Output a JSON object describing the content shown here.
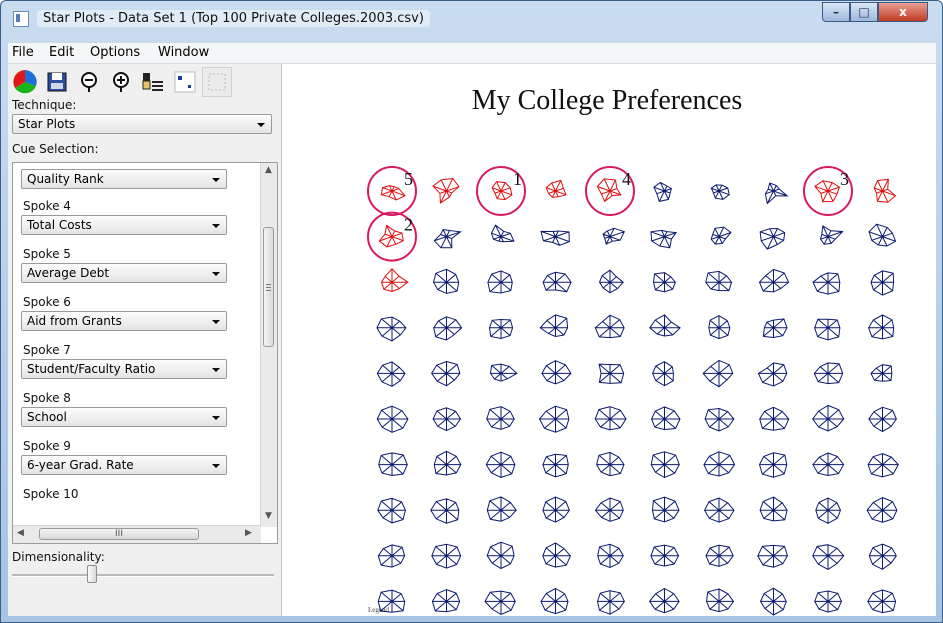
{
  "window": {
    "title": "Star Plots - Data Set 1 (Top 100 Private Colleges.2003.csv)",
    "controls": {
      "minimize": "–",
      "maximize": "□",
      "close": "x"
    }
  },
  "menu": [
    "File",
    "Edit",
    "Options",
    "Window"
  ],
  "toolbar": {
    "buttons": [
      "color-wheel-icon",
      "save-icon",
      "zoom-out-icon",
      "zoom-in-icon",
      "cue-settings-icon",
      "scatter-icon",
      "grid-icon"
    ]
  },
  "sidebar": {
    "technique_label": "Technique:",
    "technique_value": "Star Plots",
    "cue_selection_label": "Cue Selection:",
    "cues": [
      {
        "label": "",
        "value": "Quality Rank"
      },
      {
        "label": "Spoke 4",
        "value": "Total Costs"
      },
      {
        "label": "Spoke 5",
        "value": "Average Debt"
      },
      {
        "label": "Spoke 6",
        "value": "Aid from Grants"
      },
      {
        "label": "Spoke 7",
        "value": "Student/Faculty Ratio"
      },
      {
        "label": "Spoke 8",
        "value": "School"
      },
      {
        "label": "Spoke 9",
        "value": "6-year Grad. Rate"
      },
      {
        "label": "Spoke 10",
        "value": ""
      }
    ],
    "hscroll_grip": "III",
    "dimensionality_label": "Dimensionality:",
    "dimensionality_level": 0.3
  },
  "canvas": {
    "title": "My College Preferences",
    "legend_label": "Legend",
    "highlight_color": "#d81b60",
    "star_colors": {
      "highlighted": "#e01010",
      "normal": "#0d1a70"
    },
    "circled": [
      {
        "row": 0,
        "col": 0,
        "label": "5"
      },
      {
        "row": 0,
        "col": 2,
        "label": "1"
      },
      {
        "row": 0,
        "col": 4,
        "label": "4"
      },
      {
        "row": 0,
        "col": 8,
        "label": "3"
      },
      {
        "row": 1,
        "col": 0,
        "label": "2"
      }
    ],
    "red_stars": [
      [
        0,
        0
      ],
      [
        0,
        1
      ],
      [
        0,
        2
      ],
      [
        0,
        3
      ],
      [
        0,
        4
      ],
      [
        0,
        8
      ],
      [
        0,
        9
      ],
      [
        1,
        0
      ],
      [
        2,
        0
      ]
    ]
  }
}
